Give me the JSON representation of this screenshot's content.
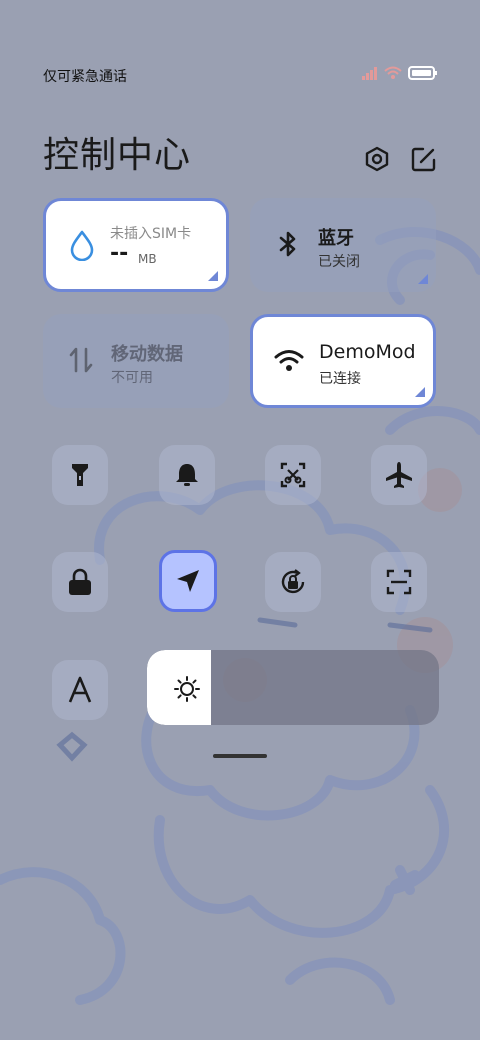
{
  "status": {
    "carrier": "仅可紧急通话",
    "icons": [
      "signal-icon",
      "wifi-icon",
      "battery-icon"
    ]
  },
  "header": {
    "title": "控制中心",
    "icons": [
      "settings-icon",
      "edit-icon"
    ]
  },
  "tiles": {
    "sim": {
      "label": "未插入SIM卡",
      "value": "--",
      "unit": "MB",
      "icon": "water-drop-icon"
    },
    "bluetooth": {
      "title": "蓝牙",
      "status": "已关闭",
      "icon": "bluetooth-icon"
    },
    "mobile_data": {
      "title": "移动数据",
      "status": "不可用",
      "icon": "data-arrows-icon"
    },
    "wifi": {
      "title": "DemoMod",
      "status": "已连接",
      "icon": "wifi-icon"
    }
  },
  "quick_toggles": [
    {
      "icon": "flashlight-icon",
      "active": false
    },
    {
      "icon": "bell-icon",
      "active": false
    },
    {
      "icon": "screenshot-icon",
      "active": false
    },
    {
      "icon": "airplane-icon",
      "active": false
    },
    {
      "icon": "lock-icon",
      "active": false
    },
    {
      "icon": "location-icon",
      "active": true
    },
    {
      "icon": "rotation-lock-icon",
      "active": false
    },
    {
      "icon": "scan-icon",
      "active": false
    },
    {
      "icon": "font-size-icon",
      "active": false
    }
  ],
  "brightness": {
    "level": 0.22,
    "icon": "sun-icon"
  },
  "colors": {
    "accent": "#6f87d6",
    "active_toggle": "#b5c3ff",
    "background": "#9aa0b2"
  }
}
